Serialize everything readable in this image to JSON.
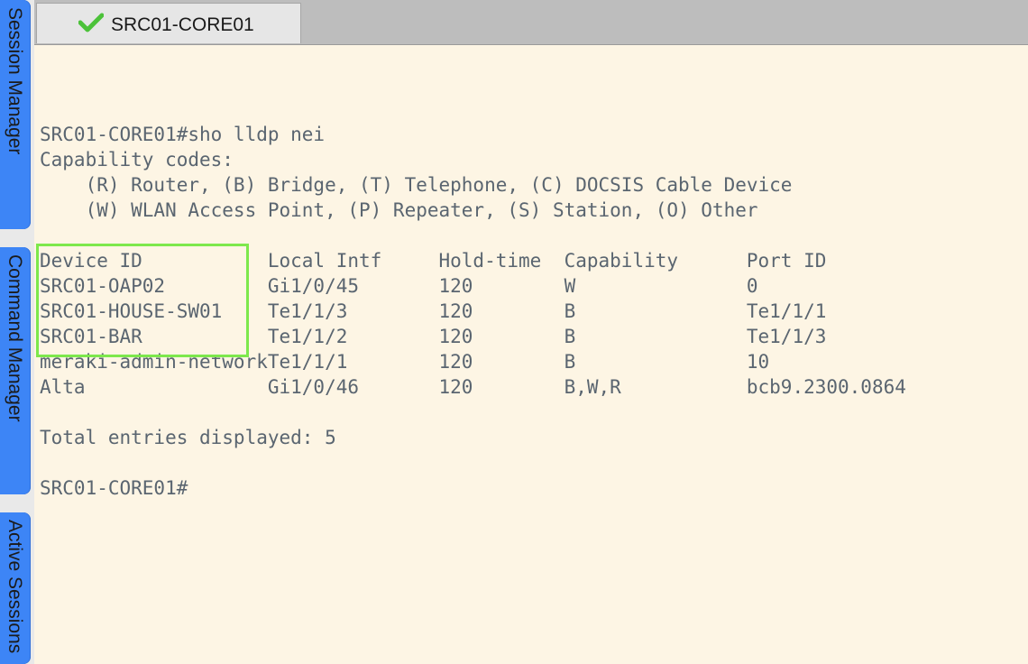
{
  "dock": {
    "tabs": [
      {
        "label": "Session Manager"
      },
      {
        "label": "Command Manager"
      },
      {
        "label": "Active Sessions"
      }
    ]
  },
  "session_tab": {
    "title": "SRC01-CORE01",
    "status_icon": "green-checkmark-icon",
    "status_color": "#4cc23a"
  },
  "terminal": {
    "lines": [
      "SRC01-CORE01#sho lldp nei",
      "Capability codes:",
      "    (R) Router, (B) Bridge, (T) Telephone, (C) DOCSIS Cable Device",
      "    (W) WLAN Access Point, (P) Repeater, (S) Station, (O) Other",
      "",
      "Device ID           Local Intf     Hold-time  Capability      Port ID",
      "SRC01-OAP02         Gi1/0/45       120        W               0",
      "SRC01-HOUSE-SW01    Te1/1/3        120        B               Te1/1/1",
      "SRC01-BAR           Te1/1/2        120        B               Te1/1/3",
      "meraki-admin-networkTe1/1/1        120        B               10",
      "Alta                Gi1/0/46       120        B,W,R           bcb9.2300.0864",
      "",
      "Total entries displayed: 5",
      "",
      "SRC01-CORE01#"
    ],
    "highlight_color": "#7de84c"
  }
}
